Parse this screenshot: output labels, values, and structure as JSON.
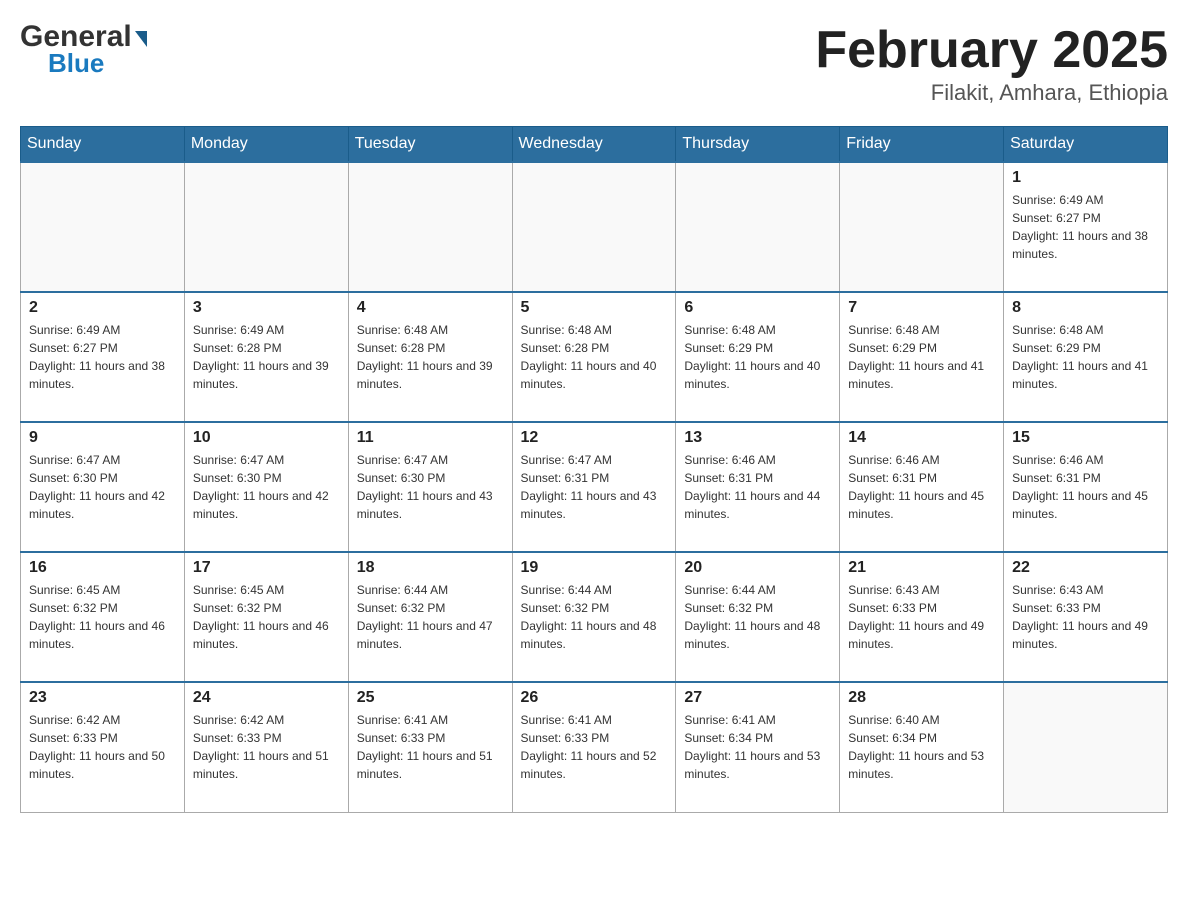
{
  "header": {
    "logo_general": "General",
    "logo_blue": "Blue",
    "month_title": "February 2025",
    "location": "Filakit, Amhara, Ethiopia"
  },
  "days_of_week": [
    "Sunday",
    "Monday",
    "Tuesday",
    "Wednesday",
    "Thursday",
    "Friday",
    "Saturday"
  ],
  "weeks": [
    [
      null,
      null,
      null,
      null,
      null,
      null,
      {
        "day": "1",
        "sunrise": "Sunrise: 6:49 AM",
        "sunset": "Sunset: 6:27 PM",
        "daylight": "Daylight: 11 hours and 38 minutes."
      }
    ],
    [
      {
        "day": "2",
        "sunrise": "Sunrise: 6:49 AM",
        "sunset": "Sunset: 6:27 PM",
        "daylight": "Daylight: 11 hours and 38 minutes."
      },
      {
        "day": "3",
        "sunrise": "Sunrise: 6:49 AM",
        "sunset": "Sunset: 6:28 PM",
        "daylight": "Daylight: 11 hours and 39 minutes."
      },
      {
        "day": "4",
        "sunrise": "Sunrise: 6:48 AM",
        "sunset": "Sunset: 6:28 PM",
        "daylight": "Daylight: 11 hours and 39 minutes."
      },
      {
        "day": "5",
        "sunrise": "Sunrise: 6:48 AM",
        "sunset": "Sunset: 6:28 PM",
        "daylight": "Daylight: 11 hours and 40 minutes."
      },
      {
        "day": "6",
        "sunrise": "Sunrise: 6:48 AM",
        "sunset": "Sunset: 6:29 PM",
        "daylight": "Daylight: 11 hours and 40 minutes."
      },
      {
        "day": "7",
        "sunrise": "Sunrise: 6:48 AM",
        "sunset": "Sunset: 6:29 PM",
        "daylight": "Daylight: 11 hours and 41 minutes."
      },
      {
        "day": "8",
        "sunrise": "Sunrise: 6:48 AM",
        "sunset": "Sunset: 6:29 PM",
        "daylight": "Daylight: 11 hours and 41 minutes."
      }
    ],
    [
      {
        "day": "9",
        "sunrise": "Sunrise: 6:47 AM",
        "sunset": "Sunset: 6:30 PM",
        "daylight": "Daylight: 11 hours and 42 minutes."
      },
      {
        "day": "10",
        "sunrise": "Sunrise: 6:47 AM",
        "sunset": "Sunset: 6:30 PM",
        "daylight": "Daylight: 11 hours and 42 minutes."
      },
      {
        "day": "11",
        "sunrise": "Sunrise: 6:47 AM",
        "sunset": "Sunset: 6:30 PM",
        "daylight": "Daylight: 11 hours and 43 minutes."
      },
      {
        "day": "12",
        "sunrise": "Sunrise: 6:47 AM",
        "sunset": "Sunset: 6:31 PM",
        "daylight": "Daylight: 11 hours and 43 minutes."
      },
      {
        "day": "13",
        "sunrise": "Sunrise: 6:46 AM",
        "sunset": "Sunset: 6:31 PM",
        "daylight": "Daylight: 11 hours and 44 minutes."
      },
      {
        "day": "14",
        "sunrise": "Sunrise: 6:46 AM",
        "sunset": "Sunset: 6:31 PM",
        "daylight": "Daylight: 11 hours and 45 minutes."
      },
      {
        "day": "15",
        "sunrise": "Sunrise: 6:46 AM",
        "sunset": "Sunset: 6:31 PM",
        "daylight": "Daylight: 11 hours and 45 minutes."
      }
    ],
    [
      {
        "day": "16",
        "sunrise": "Sunrise: 6:45 AM",
        "sunset": "Sunset: 6:32 PM",
        "daylight": "Daylight: 11 hours and 46 minutes."
      },
      {
        "day": "17",
        "sunrise": "Sunrise: 6:45 AM",
        "sunset": "Sunset: 6:32 PM",
        "daylight": "Daylight: 11 hours and 46 minutes."
      },
      {
        "day": "18",
        "sunrise": "Sunrise: 6:44 AM",
        "sunset": "Sunset: 6:32 PM",
        "daylight": "Daylight: 11 hours and 47 minutes."
      },
      {
        "day": "19",
        "sunrise": "Sunrise: 6:44 AM",
        "sunset": "Sunset: 6:32 PM",
        "daylight": "Daylight: 11 hours and 48 minutes."
      },
      {
        "day": "20",
        "sunrise": "Sunrise: 6:44 AM",
        "sunset": "Sunset: 6:32 PM",
        "daylight": "Daylight: 11 hours and 48 minutes."
      },
      {
        "day": "21",
        "sunrise": "Sunrise: 6:43 AM",
        "sunset": "Sunset: 6:33 PM",
        "daylight": "Daylight: 11 hours and 49 minutes."
      },
      {
        "day": "22",
        "sunrise": "Sunrise: 6:43 AM",
        "sunset": "Sunset: 6:33 PM",
        "daylight": "Daylight: 11 hours and 49 minutes."
      }
    ],
    [
      {
        "day": "23",
        "sunrise": "Sunrise: 6:42 AM",
        "sunset": "Sunset: 6:33 PM",
        "daylight": "Daylight: 11 hours and 50 minutes."
      },
      {
        "day": "24",
        "sunrise": "Sunrise: 6:42 AM",
        "sunset": "Sunset: 6:33 PM",
        "daylight": "Daylight: 11 hours and 51 minutes."
      },
      {
        "day": "25",
        "sunrise": "Sunrise: 6:41 AM",
        "sunset": "Sunset: 6:33 PM",
        "daylight": "Daylight: 11 hours and 51 minutes."
      },
      {
        "day": "26",
        "sunrise": "Sunrise: 6:41 AM",
        "sunset": "Sunset: 6:33 PM",
        "daylight": "Daylight: 11 hours and 52 minutes."
      },
      {
        "day": "27",
        "sunrise": "Sunrise: 6:41 AM",
        "sunset": "Sunset: 6:34 PM",
        "daylight": "Daylight: 11 hours and 53 minutes."
      },
      {
        "day": "28",
        "sunrise": "Sunrise: 6:40 AM",
        "sunset": "Sunset: 6:34 PM",
        "daylight": "Daylight: 11 hours and 53 minutes."
      },
      null
    ]
  ]
}
